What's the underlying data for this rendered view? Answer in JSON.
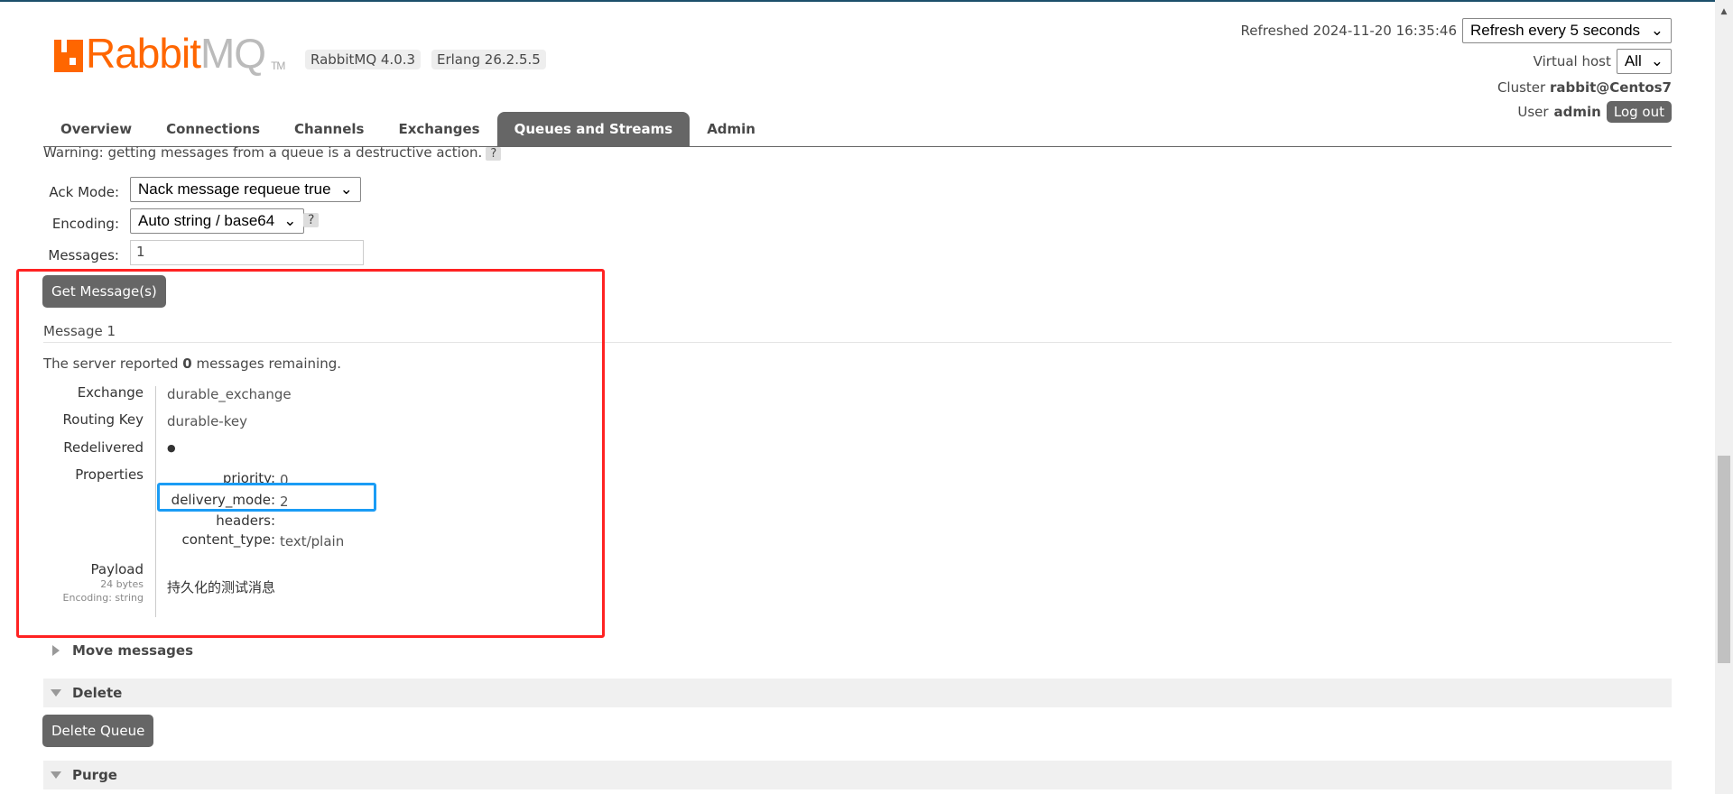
{
  "header": {
    "logo_text_a": "Rabbit",
    "logo_text_b": "MQ",
    "logo_tm": "TM",
    "rabbitmq_version": "RabbitMQ 4.0.3",
    "erlang_version": "Erlang 26.2.5.5",
    "refreshed": "Refreshed 2024-11-20 16:35:46",
    "refresh_select": "Refresh every 5 seconds",
    "vhost_label": "Virtual host",
    "vhost_select": "All",
    "cluster_label": "Cluster",
    "cluster_value": "rabbit@Centos7",
    "user_label": "User",
    "user_value": "admin",
    "logout": "Log out"
  },
  "nav": {
    "tabs": [
      {
        "label": "Overview"
      },
      {
        "label": "Connections"
      },
      {
        "label": "Channels"
      },
      {
        "label": "Exchanges"
      },
      {
        "label": "Queues and Streams",
        "active": true
      },
      {
        "label": "Admin"
      }
    ]
  },
  "get": {
    "warning": "Warning: getting messages from a queue is a destructive action.",
    "help": "?",
    "ack_label": "Ack Mode:",
    "ack_value": "Nack message requeue true",
    "encoding_label": "Encoding:",
    "encoding_value": "Auto string / base64",
    "messages_label": "Messages:",
    "messages_value": "1",
    "button": "Get Message(s)"
  },
  "message": {
    "title": "Message 1",
    "remaining_pre": "The server reported",
    "remaining_count": "0",
    "remaining_post": "messages remaining.",
    "exchange_label": "Exchange",
    "exchange": "durable_exchange",
    "routing_label": "Routing Key",
    "routing_key": "durable-key",
    "redelivered_label": "Redelivered",
    "redelivered": "●",
    "properties_label": "Properties",
    "properties": [
      {
        "k": "priority:",
        "v": "0"
      },
      {
        "k": "delivery_mode:",
        "v": "2"
      },
      {
        "k": "headers:",
        "v": ""
      },
      {
        "k": "content_type:",
        "v": "text/plain"
      }
    ],
    "payload_label": "Payload",
    "payload_size": "24 bytes",
    "payload_encoding": "Encoding: string",
    "payload": "持久化的测试消息"
  },
  "sections": {
    "move": "Move messages",
    "delete": "Delete",
    "delete_button": "Delete Queue",
    "purge": "Purge"
  },
  "colors": {
    "brand": "#ff6600",
    "annotation_red": "#ff2222",
    "annotation_blue": "#1a9cf5"
  }
}
